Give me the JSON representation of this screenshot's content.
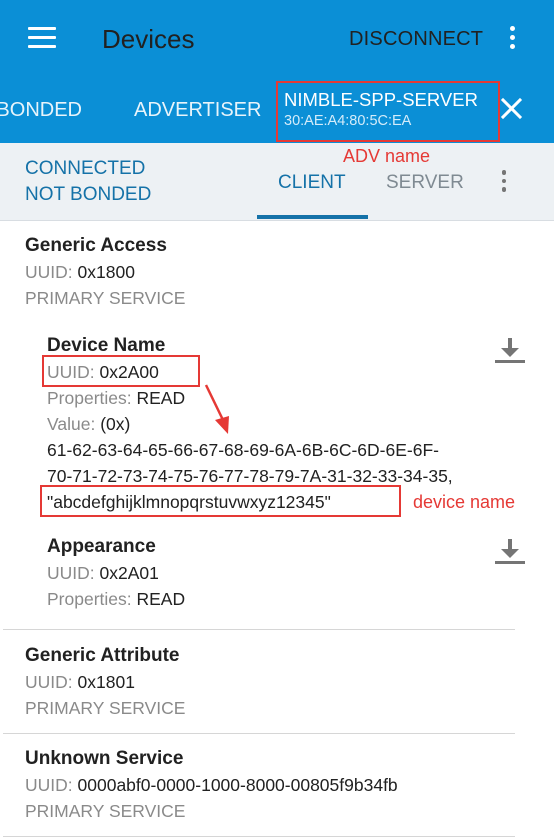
{
  "appbar": {
    "title": "Devices",
    "disconnect_label": "DISCONNECT",
    "tabs": {
      "bonded": "BONDED",
      "advertiser": "ADVERTISER",
      "active_name": "NIMBLE-SPP-SERVER",
      "active_address": "30:AE:A4:80:5C:EA"
    }
  },
  "annotations": {
    "adv_name": "ADV name",
    "device_name": "device name",
    "color": "#e53935"
  },
  "connection": {
    "state": "CONNECTED",
    "bond_state": "NOT BONDED"
  },
  "subtabs": {
    "client": "CLIENT",
    "server": "SERVER"
  },
  "labels": {
    "uuid": "UUID:",
    "properties": "Properties:",
    "value": "Value:"
  },
  "services": [
    {
      "name": "Generic Access",
      "uuid": "0x1800",
      "type": "PRIMARY SERVICE",
      "characteristics": [
        {
          "name": "Device Name",
          "uuid": "0x2A00",
          "properties": "READ",
          "value_prefix": "(0x)",
          "value_hex_1": "61-62-63-64-65-66-67-68-69-6A-6B-6C-6D-6E-6F-",
          "value_hex_2": "70-71-72-73-74-75-76-77-78-79-7A-31-32-33-34-35,",
          "value_text": "\"abcdefghijklmnopqrstuvwxyz12345\""
        },
        {
          "name": "Appearance",
          "uuid": "0x2A01",
          "properties": "READ"
        }
      ]
    },
    {
      "name": "Generic Attribute",
      "uuid": "0x1801",
      "type": "PRIMARY SERVICE"
    },
    {
      "name": "Unknown Service",
      "uuid": "0000abf0-0000-1000-8000-00805f9b34fb",
      "type": "PRIMARY SERVICE"
    }
  ],
  "colors": {
    "appbar": "#0b8fd6",
    "accent": "#1572a8",
    "subbar": "#edf1f4"
  }
}
